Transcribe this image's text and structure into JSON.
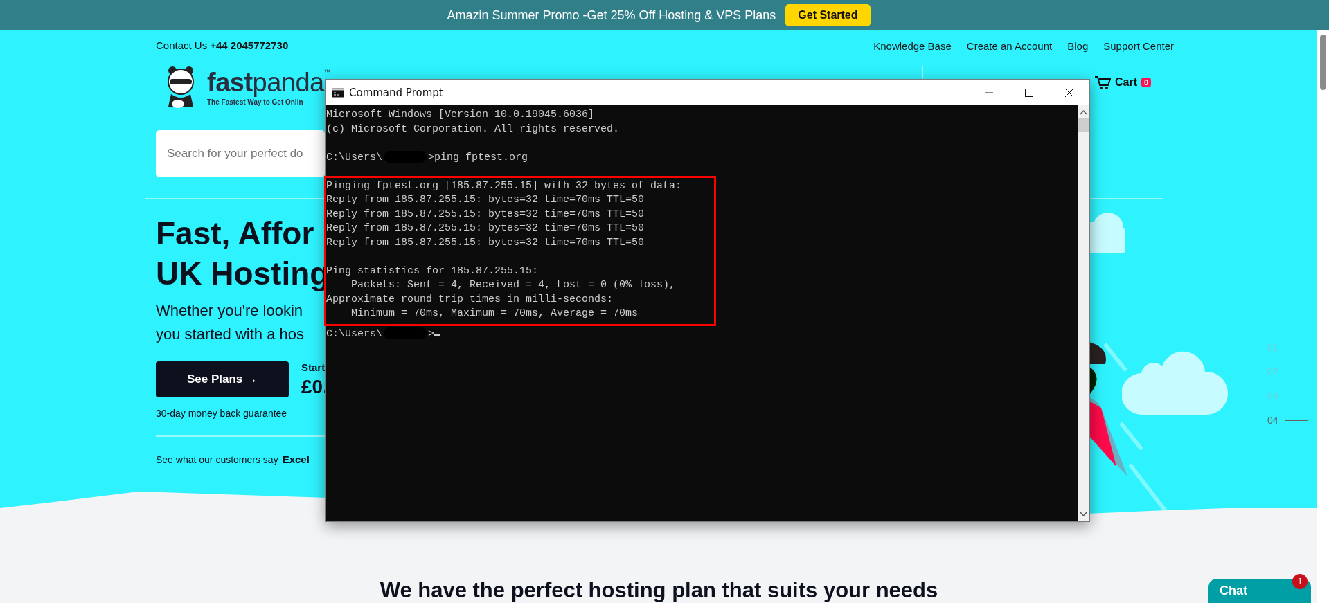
{
  "promo_bar": {
    "text": "Amazin Summer Promo -Get 25% Off Hosting & VPS Plans",
    "button": "Get Started"
  },
  "header": {
    "contact_label": "Contact Us",
    "phone": "+44 2045772730",
    "links": [
      "Knowledge Base",
      "Create an Account",
      "Blog",
      "Support Center"
    ],
    "logo": {
      "wordmark": "**fast**panda$^{™}$",
      "tagline": "The Fastest Way to Get Onlin"
    },
    "cart": {
      "label": "Cart",
      "count": "0"
    }
  },
  "search": {
    "placeholder": "Search for your perfect do"
  },
  "hero": {
    "heading_lines": [
      "Fast, Affor",
      "UK Hosting"
    ],
    "subtext_lines": [
      "Whether you're lookin",
      "you started with a hos"
    ],
    "button": "See Plans →",
    "price_label": "Start",
    "price": "£0.",
    "guarantee": "30-day money back guarantee",
    "reviews_text": "See what our customers say",
    "reviews_rating": "Excel"
  },
  "slides": [
    {
      "label": "01",
      "selected": false
    },
    {
      "label": "02",
      "selected": false
    },
    {
      "label": "03",
      "selected": false
    },
    {
      "label": "04",
      "selected": true
    }
  ],
  "section_heading": "We have the perfect hosting plan that suits your needs",
  "chat": {
    "label": "Chat",
    "badge": "1"
  },
  "terminal": {
    "title": "Command Prompt",
    "output": [
      {
        "kind": "text",
        "text": "Microsoft Windows [Version 10.0.19045.6036]"
      },
      {
        "kind": "text",
        "text": "(c) Microsoft Corporation. All rights reserved."
      },
      {
        "kind": "blank"
      },
      {
        "kind": "prompt",
        "path": "C:\\Users\\",
        "command": ">ping fptest.org"
      },
      {
        "kind": "blank"
      }
    ],
    "highlighted_output": [
      {
        "kind": "text",
        "text": "Pinging fptest.org [185.87.255.15] with 32 bytes of data:"
      },
      {
        "kind": "text",
        "text": "Reply from 185.87.255.15: bytes=32 time=70ms TTL=50"
      },
      {
        "kind": "text",
        "text": "Reply from 185.87.255.15: bytes=32 time=70ms TTL=50"
      },
      {
        "kind": "text",
        "text": "Reply from 185.87.255.15: bytes=32 time=70ms TTL=50"
      },
      {
        "kind": "text",
        "text": "Reply from 185.87.255.15: bytes=32 time=70ms TTL=50"
      },
      {
        "kind": "blank"
      },
      {
        "kind": "text",
        "text": "Ping statistics for 185.87.255.15:"
      },
      {
        "kind": "text",
        "text": "    Packets: Sent = 4, Received = 4, Lost = 0 (0% loss),"
      },
      {
        "kind": "text",
        "text": "Approximate round trip times in milli-seconds:"
      },
      {
        "kind": "text",
        "text": "    Minimum = 70ms, Maximum = 70ms, Average = 70ms"
      }
    ],
    "final_prompt": {
      "kind": "prompt",
      "path": "C:\\Users\\",
      "command": ">",
      "cursor": true
    }
  }
}
